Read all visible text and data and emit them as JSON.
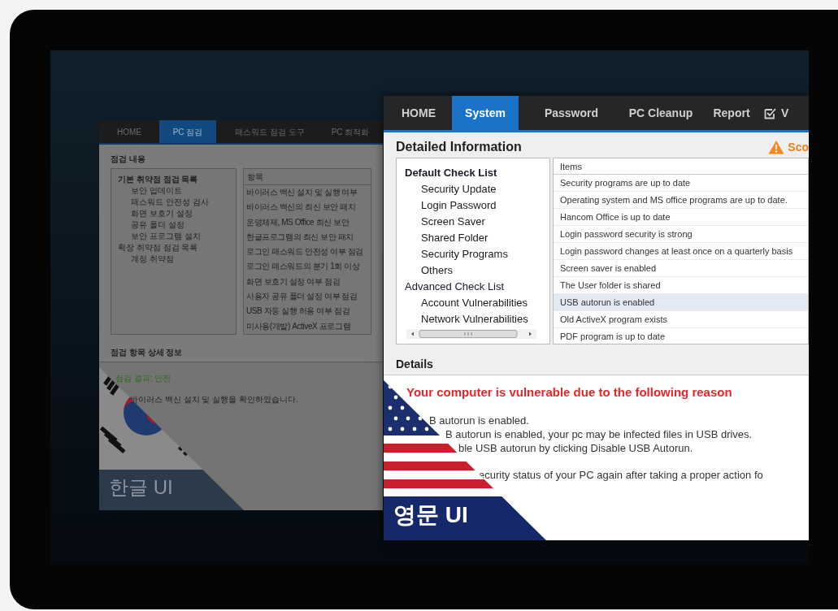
{
  "back_window": {
    "tabs": [
      {
        "label": "HOME",
        "selected": false
      },
      {
        "label": "PC 점검",
        "selected": true
      },
      {
        "label": "패스워드 점검 도구",
        "selected": false
      },
      {
        "label": "PC 최적화",
        "selected": false
      }
    ],
    "section_title": "점검 내용",
    "tree": [
      {
        "label": "기본 취약점 점검 목록",
        "selected": true,
        "children": [
          {
            "label": "보안 업데이트",
            "selected": false
          },
          {
            "label": "패스워드 안전성 검사",
            "selected": false
          },
          {
            "label": "화면 보호기 설정",
            "selected": false
          },
          {
            "label": "공유 폴더 설정",
            "selected": false
          },
          {
            "label": "보안 프로그램 설치",
            "selected": false
          }
        ]
      },
      {
        "label": "확장 취약점 점검 목록",
        "selected": false,
        "children": [
          {
            "label": "계정 취약점",
            "selected": false
          }
        ]
      }
    ],
    "table": {
      "columns": [
        "항목"
      ],
      "rows": [
        {
          "text": "바이러스 백신 설치 및 실행 여부",
          "selected": false
        },
        {
          "text": "바이러스 백신의 최신 보안 패치",
          "selected": false
        },
        {
          "text": "운영체제, MS Office 최신 보안",
          "selected": false
        },
        {
          "text": "한글프로그램의 최신 보안 패치",
          "selected": false
        },
        {
          "text": "로그인 패스워드 안전성 여부 점검",
          "selected": false
        },
        {
          "text": "로그인 패스워드의 분기 1회 이상",
          "selected": false
        },
        {
          "text": "화면 보호기 설정 여부 점검",
          "selected": false
        },
        {
          "text": "사용자 공유 폴더 설정 여부 점검",
          "selected": false
        },
        {
          "text": "USB 자동 실행 허용 여부 점검",
          "selected": false
        },
        {
          "text": "미사용(개발) ActiveX 프로그램",
          "selected": false
        }
      ]
    },
    "details_title": "점검 항목 상세 정보",
    "result": "점검 결과: 안전",
    "message": "바이러스 백신 설치 및 실행을 확인하였습니다.",
    "badge": "한글 UI"
  },
  "front_window": {
    "tabs": [
      {
        "label": "HOME",
        "selected": false
      },
      {
        "label": "System",
        "selected": true
      },
      {
        "label": "Password",
        "selected": false
      },
      {
        "label": "PC Cleanup",
        "selected": false
      },
      {
        "label": "Report",
        "selected": false
      },
      {
        "label": "V",
        "selected": false
      }
    ],
    "title": "Detailed Information",
    "warning": "Sco",
    "tree": [
      {
        "label": "Default Check List",
        "selected": true,
        "children": [
          {
            "label": "Security Update",
            "selected": false
          },
          {
            "label": "Login Password",
            "selected": false
          },
          {
            "label": "Screen Saver",
            "selected": false
          },
          {
            "label": "Shared Folder",
            "selected": false
          },
          {
            "label": "Security Programs",
            "selected": false
          },
          {
            "label": "Others",
            "selected": false
          }
        ]
      },
      {
        "label": "Advanced Check List",
        "selected": false,
        "children": [
          {
            "label": "Account Vulnerabilities",
            "selected": false
          },
          {
            "label": "Network Vulnerabilities",
            "selected": false
          }
        ]
      }
    ],
    "table": {
      "columns": [
        "Items"
      ],
      "rows": [
        {
          "text": "Security programs are up to date",
          "selected": false
        },
        {
          "text": "Operating system and MS office programs are up to date.",
          "selected": false
        },
        {
          "text": "Hancom Office is up to date",
          "selected": false
        },
        {
          "text": "Login password security is strong",
          "selected": false
        },
        {
          "text": "Login password changes at least once on a quarterly basis",
          "selected": false
        },
        {
          "text": "Screen saver is enabled",
          "selected": false
        },
        {
          "text": "The User folder is shared",
          "selected": false
        },
        {
          "text": "USB autorun is enabled",
          "selected": true
        },
        {
          "text": "Old ActiveX program exists",
          "selected": false
        },
        {
          "text": "PDF program is up to date",
          "selected": false
        }
      ]
    },
    "details_title": "Details",
    "alert": "Your computer is vulnerable due to the following reason",
    "lines": [
      "B autorun is enabled.",
      "B autorun is enabled, your pc may be infected files in USB drives.",
      "ble USB autorun by clicking Disable USB Autorun.",
      "ecurity status of your PC again after taking a proper action fo"
    ],
    "badge": "영문 UI"
  }
}
